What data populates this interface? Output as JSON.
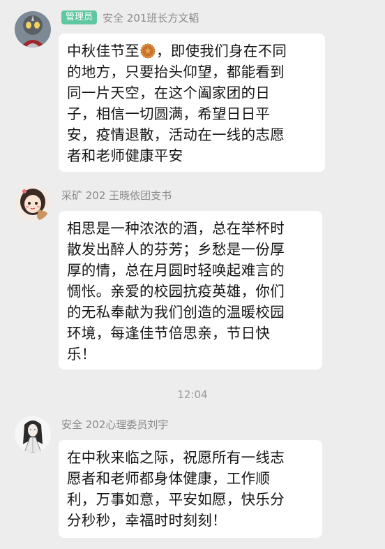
{
  "messages": [
    {
      "role_badge": "管理员",
      "sender": "安全 201班长方文韬",
      "avatar": "tokusatsu-hero-avatar",
      "lines": [
        "中秋佳节至",
        "的地方，只要抬头仰望，都能看到",
        "同一片天空，在这个阖家团的日",
        "子，相信一切圆满，希望日日平",
        "安，疫情退散，活动在一线的志愿",
        "者和老师健康平安"
      ],
      "line1_suffix": "，即使我们身在不同",
      "emoji": "mooncake-emoji"
    },
    {
      "sender": "采矿 202 王晓依团支书",
      "avatar": "cartoon-girl-avatar",
      "lines": [
        "相思是一种浓浓的酒，总在举杯时",
        "散发出醉人的芬芳；乡愁是一份厚",
        "厚的情，总在月圆时轻唤起难言的",
        "惆怅。亲爱的校园抗疫英雄，你们",
        "的无私奉献为我们创造的温暖校园",
        "环境，每逢佳节倍思亲，节日快",
        "乐！"
      ]
    },
    {
      "sender": "安全 202心理委员刘宇",
      "avatar": "ink-sketch-figure-avatar",
      "lines": [
        "在中秋来临之际，祝愿所有一线志",
        "愿者和老师都身体健康，工作顺",
        "利，万事如意，平安如愿，快乐分",
        "分秒秒，幸福时时刻刻！"
      ]
    }
  ],
  "timestamp": "12:04",
  "colors": {
    "background": "#ededed",
    "bubble": "#ffffff",
    "badge": "#5fc7a2",
    "name": "#8a8a8a"
  }
}
